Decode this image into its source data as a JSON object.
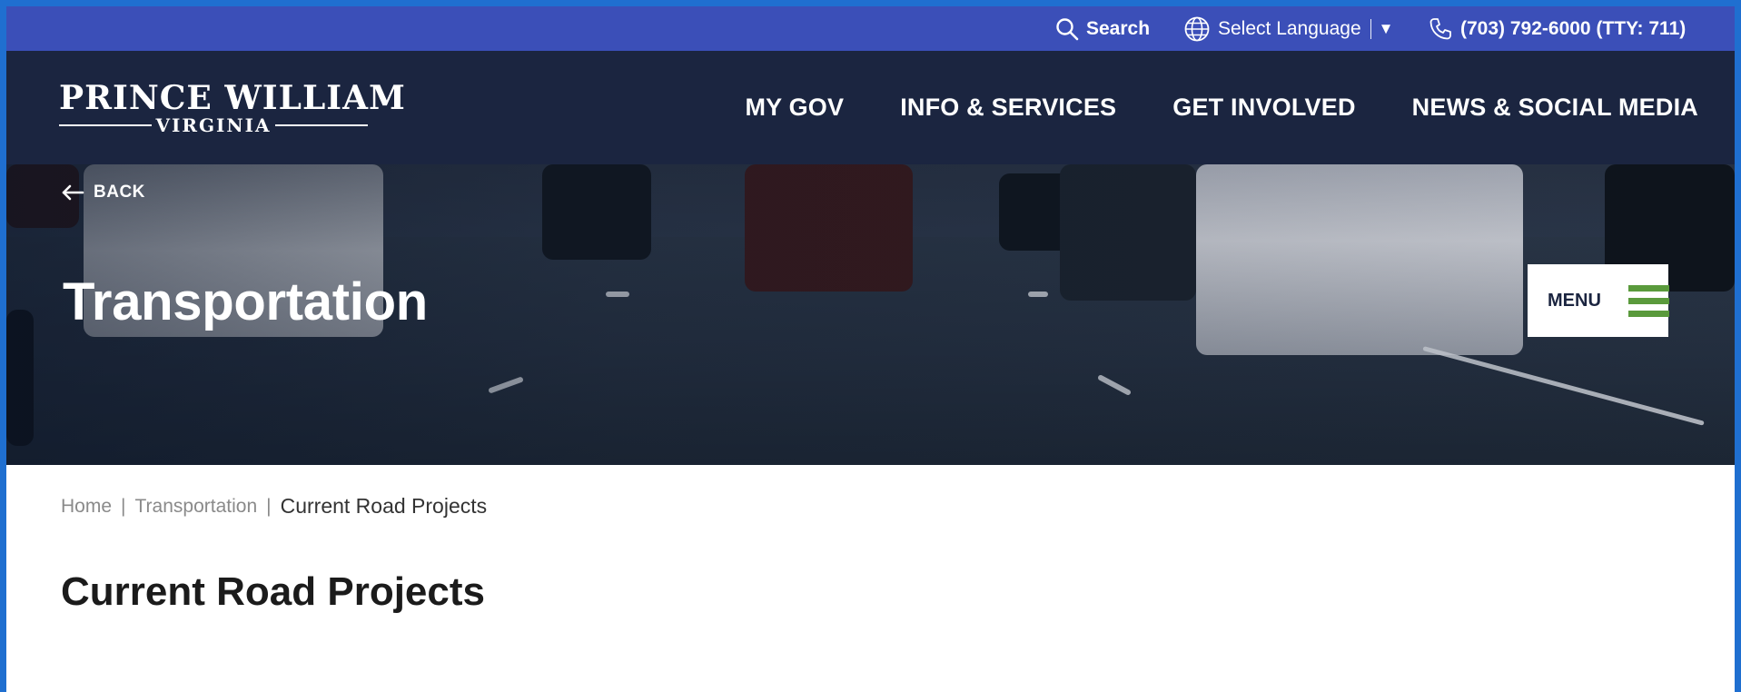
{
  "utility": {
    "search_label": "Search",
    "language_label": "Select Language",
    "language_caret": "▼",
    "phone": "(703) 792-6000 (TTY: 711)"
  },
  "logo": {
    "top": "PRINCE WILLIAM",
    "bottom": "VIRGINIA"
  },
  "nav": {
    "items": [
      "MY GOV",
      "INFO & SERVICES",
      "GET INVOLVED",
      "NEWS & SOCIAL MEDIA"
    ]
  },
  "hero": {
    "back_label": "BACK",
    "title": "Transportation",
    "menu_label": "MENU"
  },
  "breadcrumb": {
    "home": "Home",
    "section": "Transportation",
    "current": "Current Road Projects"
  },
  "page": {
    "title": "Current Road Projects"
  },
  "colors": {
    "utility_bar": "#3b4fb8",
    "header": "#1b2540",
    "menu_icon": "#5a9a3c",
    "frame": "#1f6fd0"
  }
}
